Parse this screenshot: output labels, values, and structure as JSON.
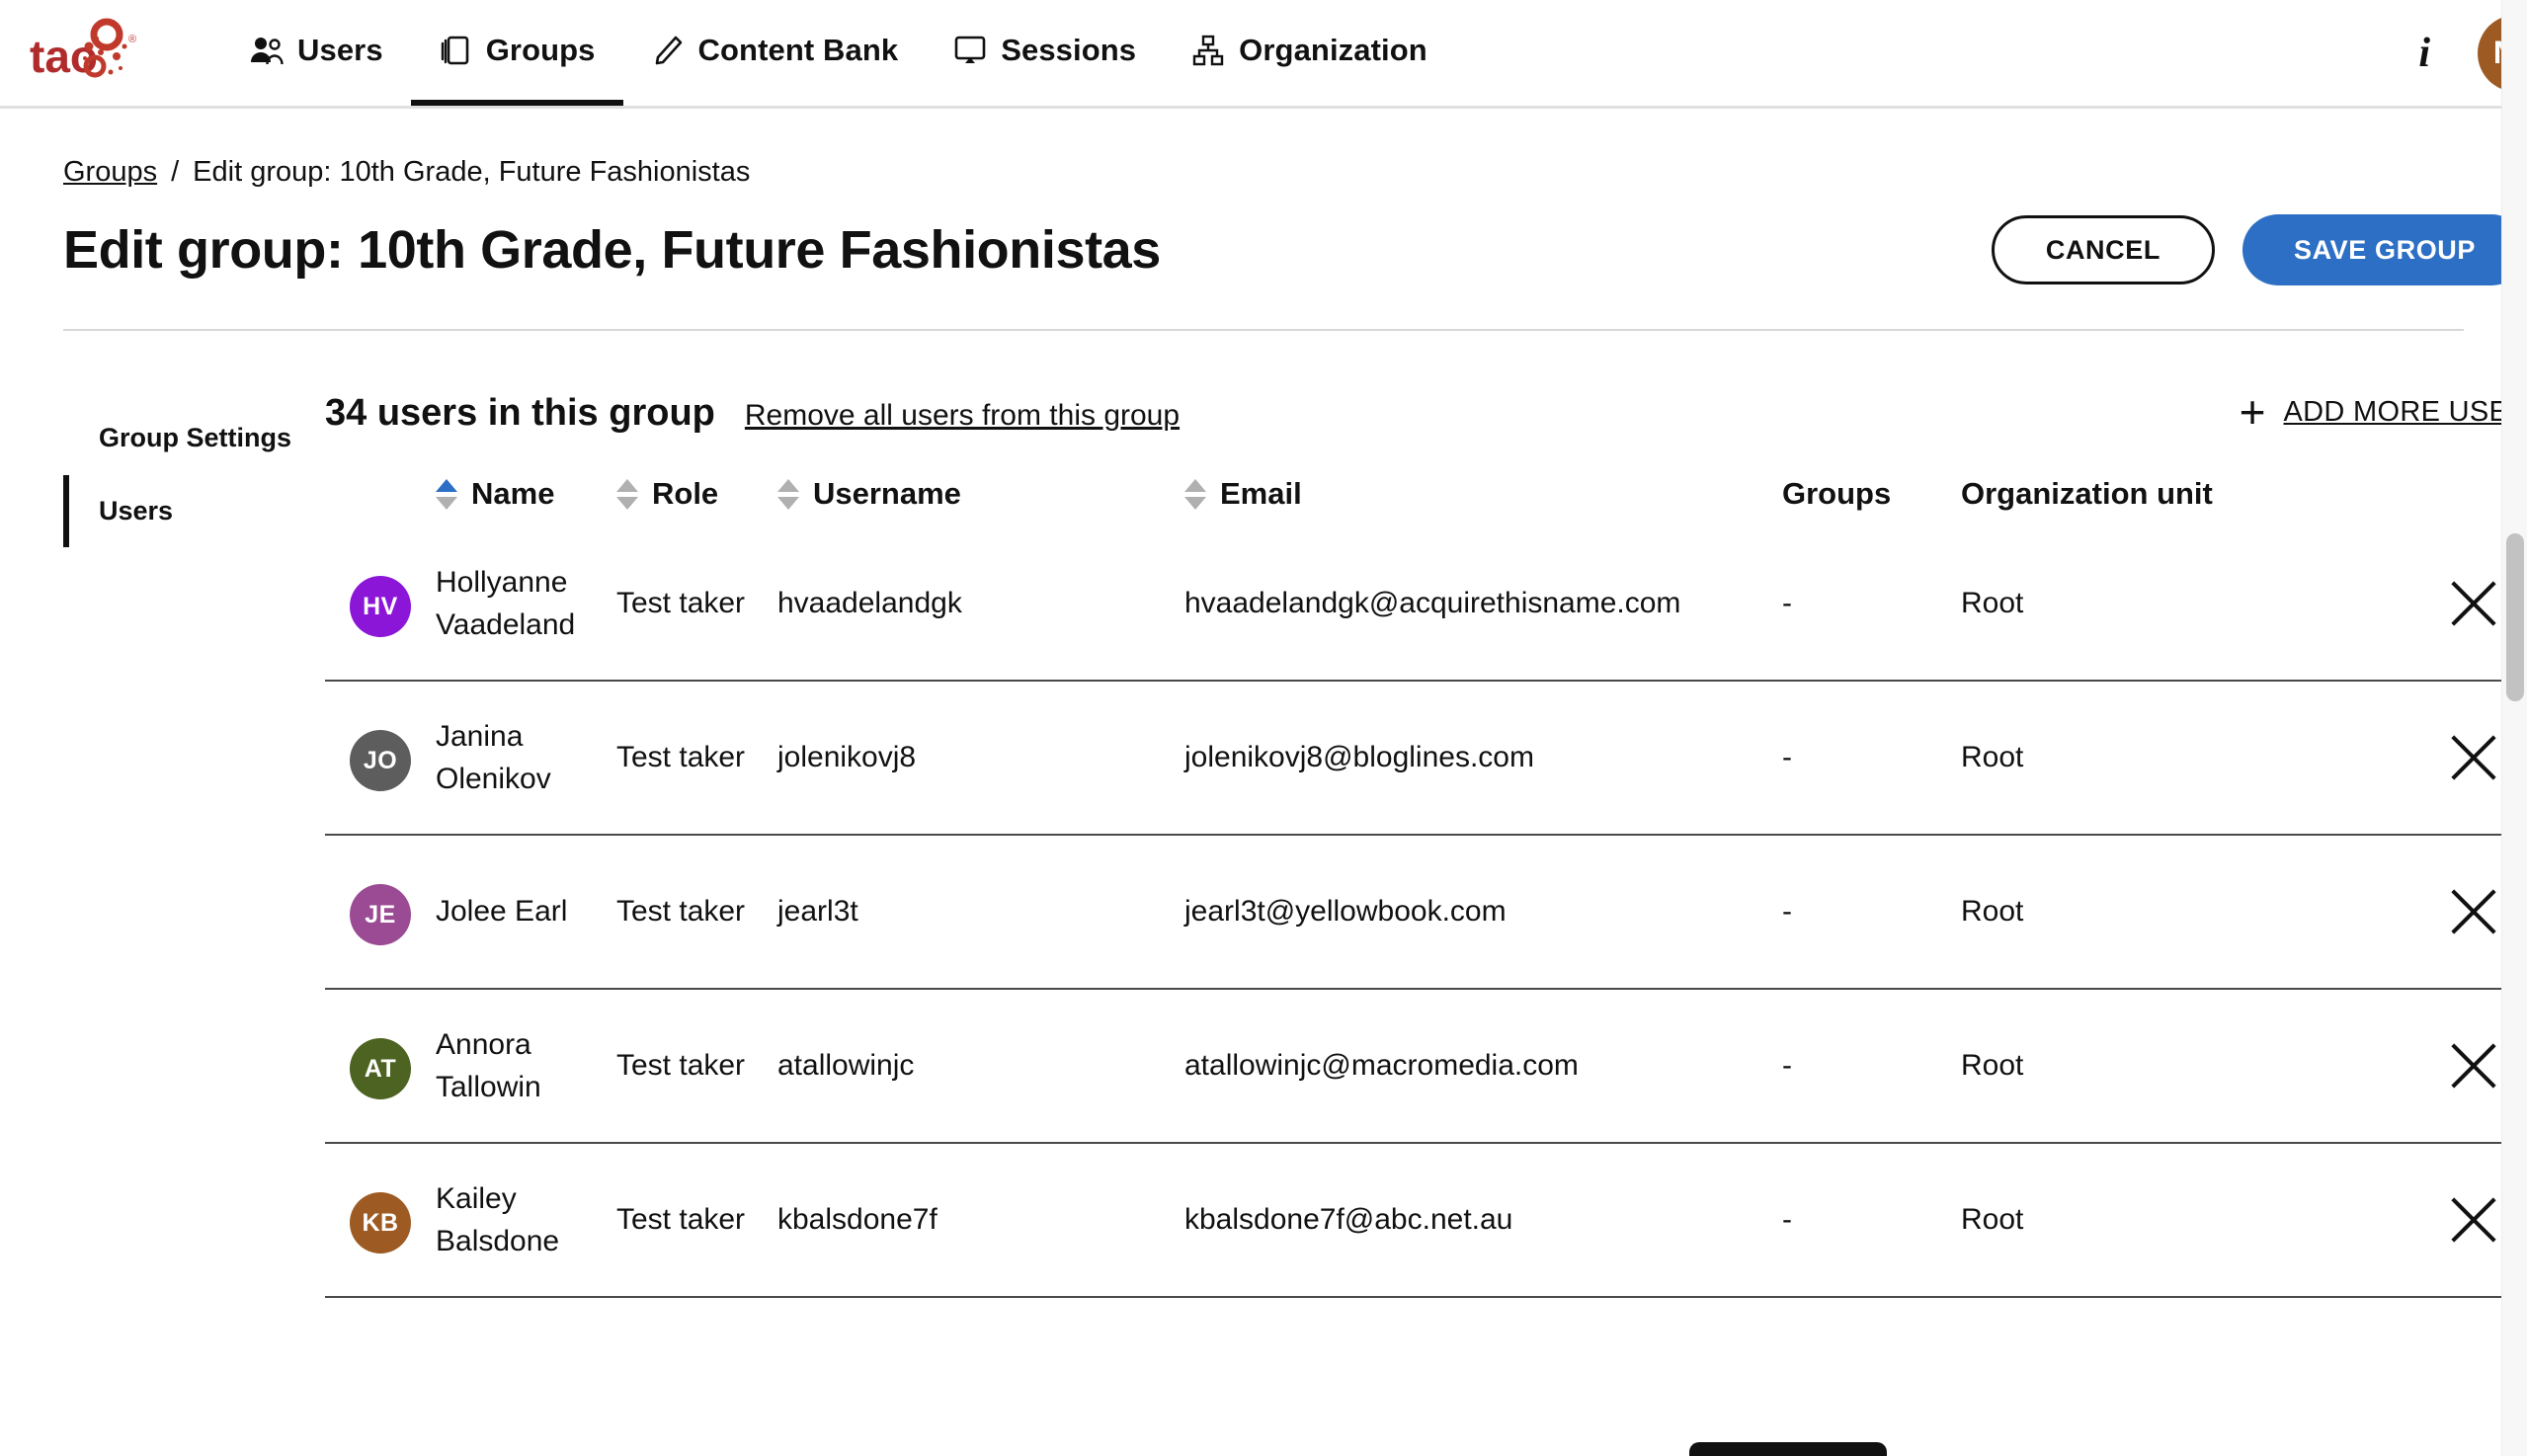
{
  "nav": {
    "logo_alt": "tao",
    "items": [
      {
        "label": "Users",
        "icon": "users-icon",
        "active": false
      },
      {
        "label": "Groups",
        "icon": "groups-icon",
        "active": true
      },
      {
        "label": "Content Bank",
        "icon": "pencil-icon",
        "active": false
      },
      {
        "label": "Sessions",
        "icon": "monitor-icon",
        "active": false
      },
      {
        "label": "Organization",
        "icon": "org-chart-icon",
        "active": false
      }
    ],
    "info_icon": "info-icon",
    "avatar_initials": "NN",
    "avatar_color": "#9d5b23"
  },
  "breadcrumb": {
    "root": "Groups",
    "separator": "/",
    "current": "Edit group: 10th Grade, Future Fashionistas"
  },
  "header": {
    "title": "Edit group: 10th Grade, Future Fashionistas",
    "cancel_label": "CANCEL",
    "save_label": "SAVE GROUP",
    "save_color": "#2d6fc4"
  },
  "sidebar": {
    "items": [
      {
        "label": "Group Settings",
        "active": false
      },
      {
        "label": "Users",
        "active": true
      }
    ]
  },
  "users_section": {
    "count_label": "34 users in this group",
    "remove_all_label": "Remove all users from this group",
    "add_more_label": "ADD MORE USERS",
    "add_more_icon": "plus-icon"
  },
  "table": {
    "columns": [
      {
        "key": "name",
        "label": "Name",
        "sortable": true,
        "sort": "asc"
      },
      {
        "key": "role",
        "label": "Role",
        "sortable": true,
        "sort": "none"
      },
      {
        "key": "username",
        "label": "Username",
        "sortable": true,
        "sort": "none"
      },
      {
        "key": "email",
        "label": "Email",
        "sortable": true,
        "sort": "none"
      },
      {
        "key": "groups",
        "label": "Groups",
        "sortable": false,
        "sort": "none"
      },
      {
        "key": "org",
        "label": "Organization unit",
        "sortable": false,
        "sort": "none"
      }
    ],
    "sort_active_color": "#2d6fc4",
    "rows": [
      {
        "initials": "HV",
        "avatar_color": "#8b16d8",
        "name": "Hollyanne Vaadeland",
        "role": "Test taker",
        "username": "hvaadelandgk",
        "email": "hvaadelandgk@acquirethisname.com",
        "groups": "-",
        "org": "Root",
        "remove_icon": "close-icon"
      },
      {
        "initials": "JO",
        "avatar_color": "#5d5d5d",
        "name": "Janina Olenikov",
        "role": "Test taker",
        "username": "jolenikovj8",
        "email": "jolenikovj8@bloglines.com",
        "groups": "-",
        "org": "Root",
        "remove_icon": "close-icon"
      },
      {
        "initials": "JE",
        "avatar_color": "#9b4a94",
        "name": "Jolee Earl",
        "role": "Test taker",
        "username": "jearl3t",
        "email": "jearl3t@yellowbook.com",
        "groups": "-",
        "org": "Root",
        "remove_icon": "close-icon"
      },
      {
        "initials": "AT",
        "avatar_color": "#4c6321",
        "name": "Annora Tallowin",
        "role": "Test taker",
        "username": "atallowinjc",
        "email": "atallowinjc@macromedia.com",
        "groups": "-",
        "org": "Root",
        "remove_icon": "close-icon"
      },
      {
        "initials": "KB",
        "avatar_color": "#9d5b23",
        "name": "Kailey Balsdone",
        "role": "Test taker",
        "username": "kbalsdone7f",
        "email": "kbalsdone7f@abc.net.au",
        "groups": "-",
        "org": "Root",
        "remove_icon": "close-icon"
      }
    ]
  }
}
